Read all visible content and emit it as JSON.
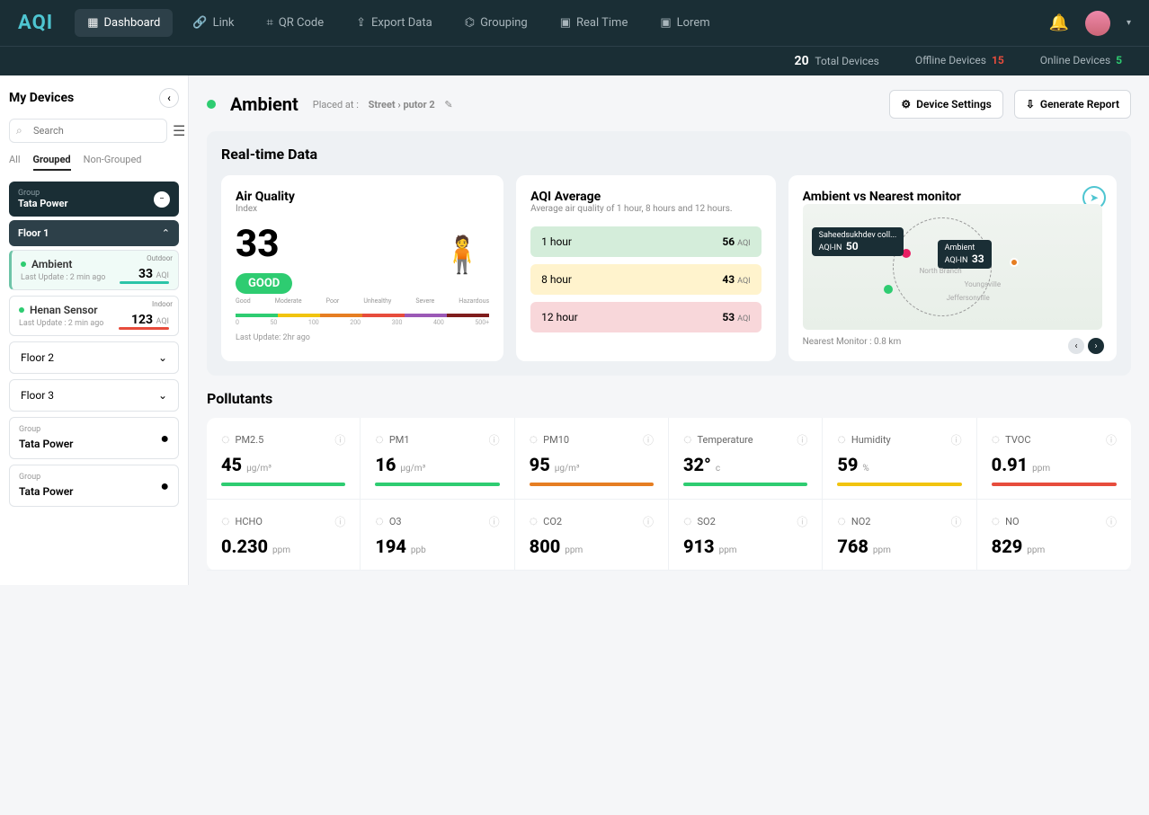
{
  "brand": "AQI",
  "nav": {
    "dashboard": "Dashboard",
    "link": "Link",
    "qr": "QR Code",
    "export": "Export Data",
    "grouping": "Grouping",
    "realtime": "Real Time",
    "lorem": "Lorem"
  },
  "status": {
    "total_count": "20",
    "total_label": "Total Devices",
    "offline_label": "Offline Devices",
    "offline_count": "15",
    "online_label": "Online Devices",
    "online_count": "5"
  },
  "sidebar": {
    "title": "My Devices",
    "search_placeholder": "Search",
    "tabs": {
      "all": "All",
      "grouped": "Grouped",
      "nongrouped": "Non-Grouped"
    },
    "group_label": "Group",
    "group1_name": "Tata Power",
    "floor1": "Floor 1",
    "dev1": {
      "tag": "Outdoor",
      "name": "Ambient",
      "sub": "Last Update : 2 min ago",
      "val": "33",
      "unit": "AQI"
    },
    "dev2": {
      "tag": "Indoor",
      "name": "Henan Sensor",
      "sub": "Last Update : 2 min ago",
      "val": "123",
      "unit": "AQI"
    },
    "floor2": "Floor 2",
    "floor3": "Floor 3",
    "group2_name": "Tata Power",
    "group3_name": "Tata Power"
  },
  "page": {
    "title": "Ambient",
    "placed_label": "Placed at :",
    "placed_path": "Street › putor 2",
    "settings": "Device Settings",
    "report": "Generate Report"
  },
  "realtime": {
    "title": "Real-time Data",
    "aqi": {
      "title": "Air Quality",
      "sub": "Index",
      "value": "33",
      "badge": "GOOD",
      "scale": [
        "Good",
        "Moderate",
        "Poor",
        "Unhealthy",
        "Severe",
        "Hazardous"
      ],
      "scale_nums": [
        "0",
        "50",
        "100",
        "200",
        "300",
        "400",
        "500+"
      ],
      "updated": "Last Update: 2hr ago"
    },
    "avg": {
      "title": "AQI Average",
      "sub": "Average air quality of 1 hour, 8 hours and 12 hours.",
      "rows": [
        {
          "label": "1 hour",
          "value": "56",
          "unit": "AQI"
        },
        {
          "label": "8 hour",
          "value": "43",
          "unit": "AQI"
        },
        {
          "label": "12 hour",
          "value": "53",
          "unit": "AQI"
        }
      ]
    },
    "map": {
      "title": "Ambient vs Nearest monitor",
      "tip1_name": "Saheedsukhdev coll...",
      "tip1_label": "AQI-IN",
      "tip1_val": "50",
      "tip2_name": "Ambient",
      "tip2_label": "AQI-IN",
      "tip2_val": "33",
      "nearest_label": "Nearest Monitor :",
      "nearest_val": "0.8 km"
    }
  },
  "pollutants": {
    "title": "Pollutants",
    "cells": [
      {
        "name": "PM2.5",
        "val": "45",
        "unit": "μg/m³",
        "bar": "pb-green"
      },
      {
        "name": "PM1",
        "val": "16",
        "unit": "μg/m³",
        "bar": "pb-green"
      },
      {
        "name": "PM10",
        "val": "95",
        "unit": "μg/m³",
        "bar": "pb-orange"
      },
      {
        "name": "Temperature",
        "val": "32°",
        "unit": "c",
        "bar": "pb-green"
      },
      {
        "name": "Humidity",
        "val": "59",
        "unit": "%",
        "bar": "pb-yellow"
      },
      {
        "name": "TVOC",
        "val": "0.91",
        "unit": "ppm",
        "bar": "pb-red"
      },
      {
        "name": "HCHO",
        "val": "0.230",
        "unit": "ppm",
        "bar": ""
      },
      {
        "name": "O3",
        "val": "194",
        "unit": "ppb",
        "bar": ""
      },
      {
        "name": "CO2",
        "val": "800",
        "unit": "ppm",
        "bar": ""
      },
      {
        "name": "SO2",
        "val": "913",
        "unit": "ppm",
        "bar": ""
      },
      {
        "name": "NO2",
        "val": "768",
        "unit": "ppm",
        "bar": ""
      },
      {
        "name": "NO",
        "val": "829",
        "unit": "ppm",
        "bar": ""
      }
    ]
  }
}
